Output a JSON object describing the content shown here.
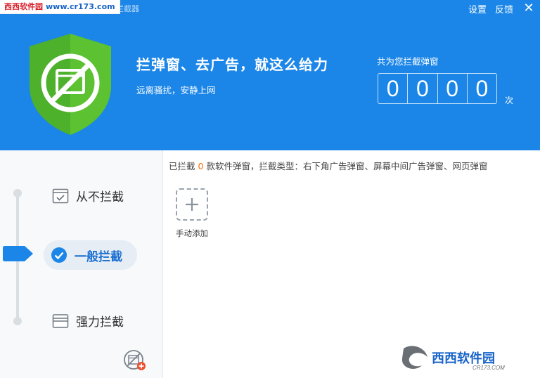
{
  "watermark": {
    "top_site": "西西软件园",
    "top_url": "www.cr173.com",
    "corner_brand": "西西软件园",
    "corner_url": "CR173.COM"
  },
  "header": {
    "title": "360弹窗拦截器",
    "settings_label": "设置",
    "feedback_label": "反馈",
    "close_symbol": "✕",
    "headline": "拦弹窗、去广告，就这么给力",
    "subline": "远离骚扰，安静上网"
  },
  "counter": {
    "label": "共为您拦截弹窗",
    "digits": [
      "0",
      "0",
      "0",
      "0"
    ],
    "unit": "次"
  },
  "levels": {
    "never": "从不拦截",
    "normal": "一般拦截",
    "strong": "强力拦截",
    "selected": "normal"
  },
  "info": {
    "prefix": "已拦截",
    "count": "0",
    "suffix": "款软件弹窗，拦截类型：右下角广告弹窗、屏幕中间广告弹窗、网页弹窗"
  },
  "add_tile": {
    "label": "手动添加"
  },
  "colors": {
    "header_blue": "#1b86e8",
    "shield_green": "#5cc232",
    "accent_blue": "#1b6fd1",
    "count_orange": "#ff6a00"
  }
}
